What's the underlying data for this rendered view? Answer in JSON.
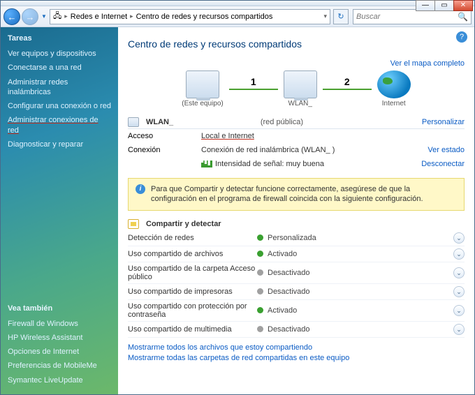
{
  "navbar": {
    "crumb1": "Redes e Internet",
    "crumb2": "Centro de redes y recursos compartidos",
    "search_placeholder": "Buscar"
  },
  "sidebar": {
    "tasks_head": "Tareas",
    "tasks": [
      "Ver equipos y dispositivos",
      "Conectarse a una red",
      "Administrar redes inalámbricas",
      "Configurar una conexión o red",
      "Administrar conexiones de red",
      "Diagnosticar y reparar"
    ],
    "see_also_head": "Vea también",
    "see_also": [
      "Firewall de Windows",
      "HP Wireless Assistant",
      "Opciones de Internet",
      "Preferencias de MobileMe",
      "Symantec LiveUpdate"
    ]
  },
  "page": {
    "title": "Centro de redes y recursos compartidos",
    "map_link": "Ver el mapa completo",
    "nodes": {
      "this_pc": "(Este equipo)",
      "router": "WLAN_",
      "internet": "Internet",
      "num1": "1",
      "num2": "2"
    }
  },
  "net": {
    "name": "WLAN_",
    "type": "(red pública)",
    "customize": "Personalizar",
    "access_k": "Acceso",
    "access_v": "Local e Internet",
    "conn_k": "Conexión",
    "conn_v": "Conexión de red inalámbrica (WLAN_ )",
    "state": "Ver estado",
    "signal_k": "Intensidad de señal: muy buena",
    "disconnect": "Desconectar"
  },
  "infobox": "Para que Compartir y detectar funcione correctamente, asegúrese de que la configuración en el programa de firewall coincida con la siguiente configuración.",
  "sharing": {
    "head": "Compartir y detectar",
    "rows": [
      {
        "label": "Detección de redes",
        "status": "Personalizada",
        "on": true
      },
      {
        "label": "Uso compartido de archivos",
        "status": "Activado",
        "on": true
      },
      {
        "label": "Uso compartido de la carpeta Acceso público",
        "status": "Desactivado",
        "on": false
      },
      {
        "label": "Uso compartido de impresoras",
        "status": "Desactivado",
        "on": false
      },
      {
        "label": "Uso compartido con protección por contraseña",
        "status": "Activado",
        "on": true
      },
      {
        "label": "Uso compartido de multimedia",
        "status": "Desactivado",
        "on": false
      }
    ]
  },
  "footer": {
    "l1": "Mostrarme todos los archivos que estoy compartiendo",
    "l2": "Mostrarme todas las carpetas de red compartidas en este equipo"
  }
}
